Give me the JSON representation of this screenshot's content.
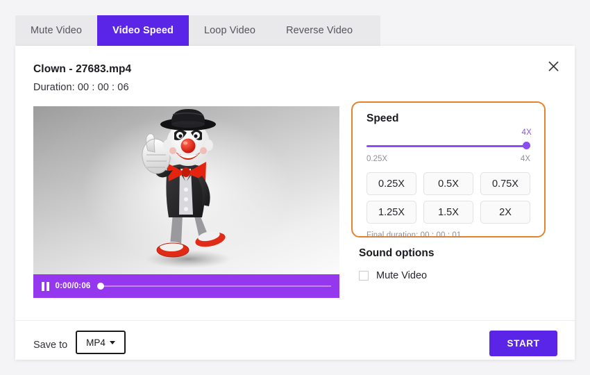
{
  "tabs": [
    {
      "label": "Mute Video",
      "active": false
    },
    {
      "label": "Video Speed",
      "active": true
    },
    {
      "label": "Loop Video",
      "active": false
    },
    {
      "label": "Reverse Video",
      "active": false
    }
  ],
  "dialog": {
    "close_icon": "close-icon",
    "file_title": "Clown - 27683.mp4",
    "duration": "Duration: 00 : 00 : 06"
  },
  "player": {
    "pause_icon": "pause-icon",
    "time": "0:00/0:06",
    "progress_percent": 0
  },
  "speed": {
    "title": "Speed",
    "slider_value": "4X",
    "min_label": "0.25X",
    "max_label": "4X",
    "slider_position_percent": 100,
    "presets": [
      "0.25X",
      "0.5X",
      "0.75X",
      "1.25X",
      "1.5X",
      "2X"
    ],
    "final_duration": "Final duration:  00 : 00 : 01"
  },
  "sound": {
    "title": "Sound options",
    "mute_label": "Mute Video",
    "mute_checked": false
  },
  "footer": {
    "save_to_label": "Save to",
    "format_value": "MP4",
    "format_caret_icon": "chevron-down-icon",
    "start_label": "START"
  },
  "colors": {
    "accent_purple": "#5b25e8",
    "slider_purple": "#8b4ff0",
    "player_purple": "#9637f0",
    "panel_orange": "#e5822e"
  }
}
